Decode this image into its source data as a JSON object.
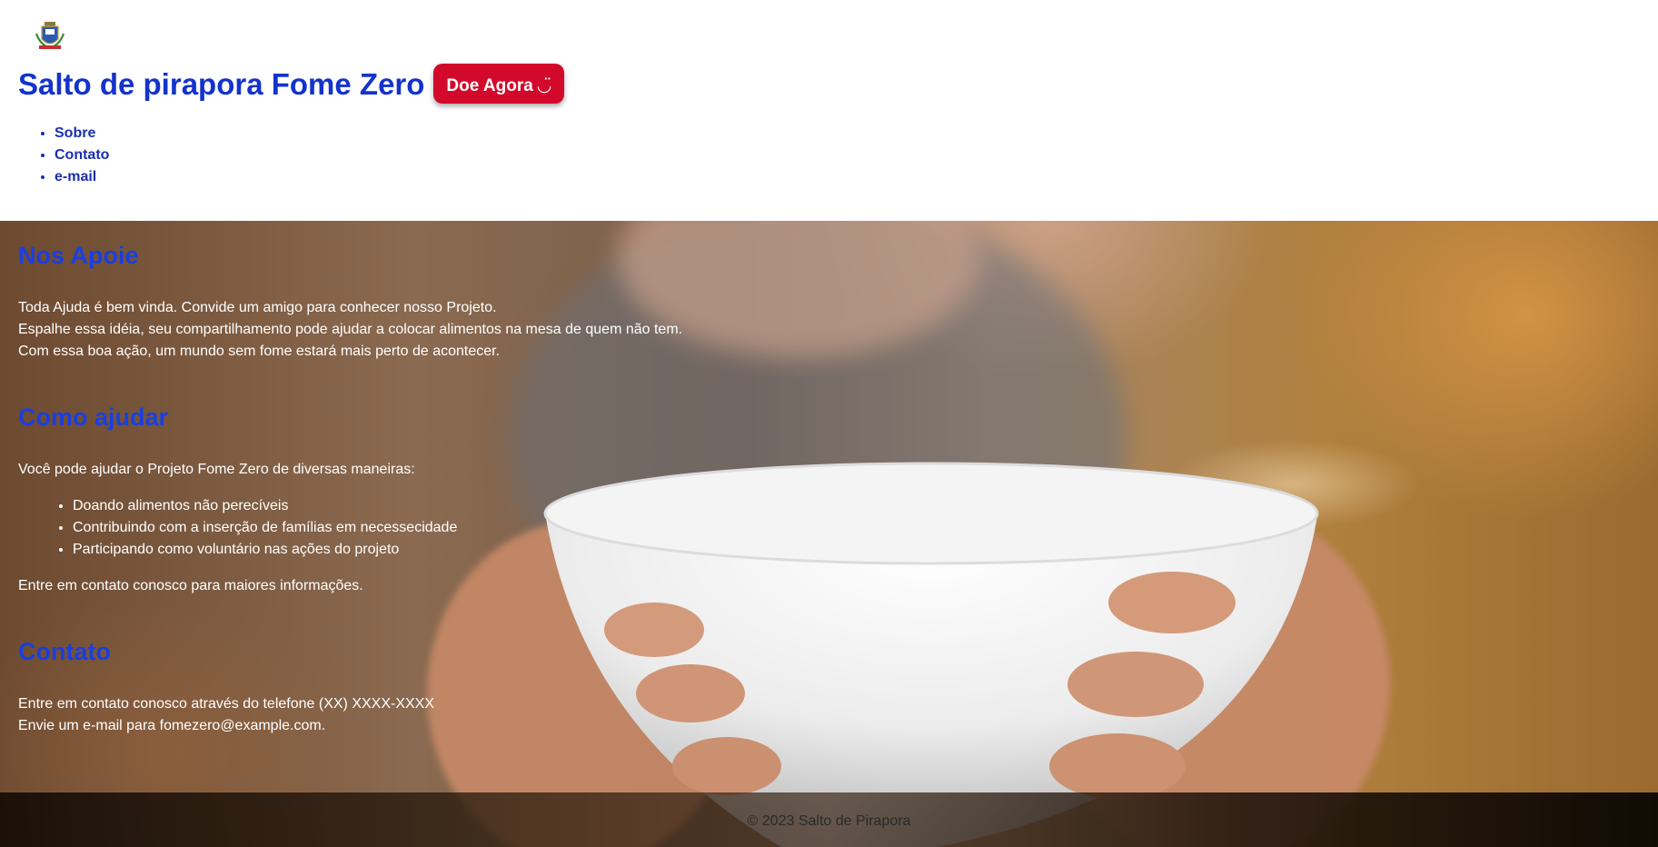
{
  "header": {
    "logo_icon": "municipal-coat-of-arms-icon",
    "site_title": "Salto de pirapora Fome Zero",
    "donate_label": "Doe Agora",
    "donate_icon": "smile-icon",
    "donate_color": "#d3092b",
    "title_color": "#1433cc"
  },
  "nav": {
    "items": [
      {
        "label": "Sobre"
      },
      {
        "label": "Contato"
      },
      {
        "label": "e-mail"
      }
    ]
  },
  "sections": {
    "support": {
      "title": "Nos Apoie",
      "lines": [
        "Toda Ajuda é bem vinda. Convide um amigo para conhecer nosso Projeto.",
        "Espalhe essa idéia, seu compartilhamento pode ajudar a colocar alimentos na mesa de quem não tem.",
        "Com essa boa ação, um mundo sem fome estará mais perto de acontecer."
      ]
    },
    "how_to_help": {
      "title": "Como ajudar",
      "intro": "Você pode ajudar o Projeto Fome Zero de diversas maneiras:",
      "items": [
        "Doando alimentos não perecíveis",
        "Contribuindo com a inserção de famílias em necessecidade",
        "Participando como voluntário nas ações do projeto"
      ],
      "outro": "Entre em contato conosco para maiores informações."
    },
    "contact": {
      "title": "Contato",
      "lines": [
        "Entre em contato conosco através do telefone (XX) XXXX-XXXX",
        "Envie um e-mail para fomezero@example.com."
      ]
    }
  },
  "footer": {
    "text": "© 2023 Salto de Pirapora"
  }
}
